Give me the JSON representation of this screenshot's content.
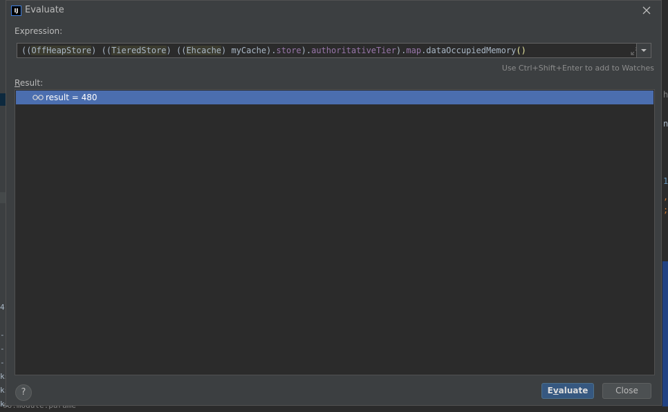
{
  "window": {
    "title": "Evaluate",
    "app_icon_text": "IJ"
  },
  "expression": {
    "label": "Expression:",
    "tokens": [
      {
        "text": "((",
        "kind": "plain"
      },
      {
        "text": "OffHeapStore",
        "kind": "cls"
      },
      {
        "text": ") ((",
        "kind": "plain"
      },
      {
        "text": "TieredStore",
        "kind": "cls"
      },
      {
        "text": ") ((",
        "kind": "plain"
      },
      {
        "text": "Ehcache",
        "kind": "cls"
      },
      {
        "text": ") myCache).",
        "kind": "plain"
      },
      {
        "text": "store",
        "kind": "field"
      },
      {
        "text": ").",
        "kind": "plain"
      },
      {
        "text": "authoritativeTier",
        "kind": "field"
      },
      {
        "text": ").",
        "kind": "plain"
      },
      {
        "text": "map",
        "kind": "field"
      },
      {
        "text": ".dataOccupiedMemory",
        "kind": "plain"
      },
      {
        "text": "()",
        "kind": "paren"
      }
    ],
    "hint": "Use Ctrl+Shift+Enter to add to Watches"
  },
  "result": {
    "label_mnemonic": "R",
    "label_rest": "esult:",
    "row_text": "result = 480"
  },
  "buttons": {
    "help": "?",
    "evaluate_mnemonic": "v",
    "evaluate_pre": "E",
    "evaluate_post": "aluate",
    "close": "Close"
  },
  "background_fragments": {
    "left": [
      "4",
      "--",
      "--",
      "--",
      "ks",
      "ks",
      "ks"
    ],
    "bottom_left": "so.module.parame",
    "right": [
      "n",
      "1",
      ",",
      ";",
      "h"
    ]
  },
  "colors": {
    "dialog_bg": "#3c3f41",
    "editor_bg": "#2b2b2b",
    "selection": "#4b6eaf",
    "primary_button": "#365880",
    "field": "#9876aa"
  }
}
